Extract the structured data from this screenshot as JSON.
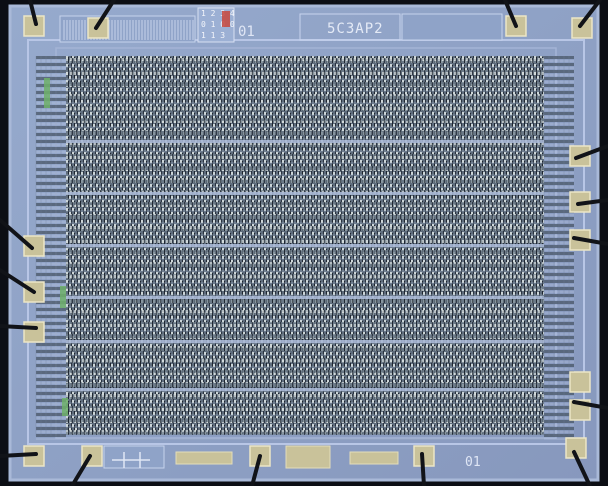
{
  "photo": {
    "subject": "",
    "chip_marking": "5C3AP2",
    "mask_code_top": "01",
    "mask_code_bottom": "01",
    "legend": {
      "row1": [
        "1",
        "2",
        "3",
        "4"
      ],
      "row2": [
        "0",
        "1",
        "0",
        "0"
      ],
      "row3": [
        "1",
        "1",
        "3",
        ""
      ]
    },
    "colors": {
      "background": "#0c0e14",
      "die": "#8fa3c8",
      "die_edge": "#a9b9d8",
      "trace": "#b8c6e6",
      "array_dark": "#2a3340",
      "array_mid": "#6f7f8e",
      "array_light": "#cdd6d8",
      "pad": "#c9c29a",
      "wire": "#111318",
      "red_mark": "#c8483c",
      "green_mark": "#6fb06a"
    }
  }
}
